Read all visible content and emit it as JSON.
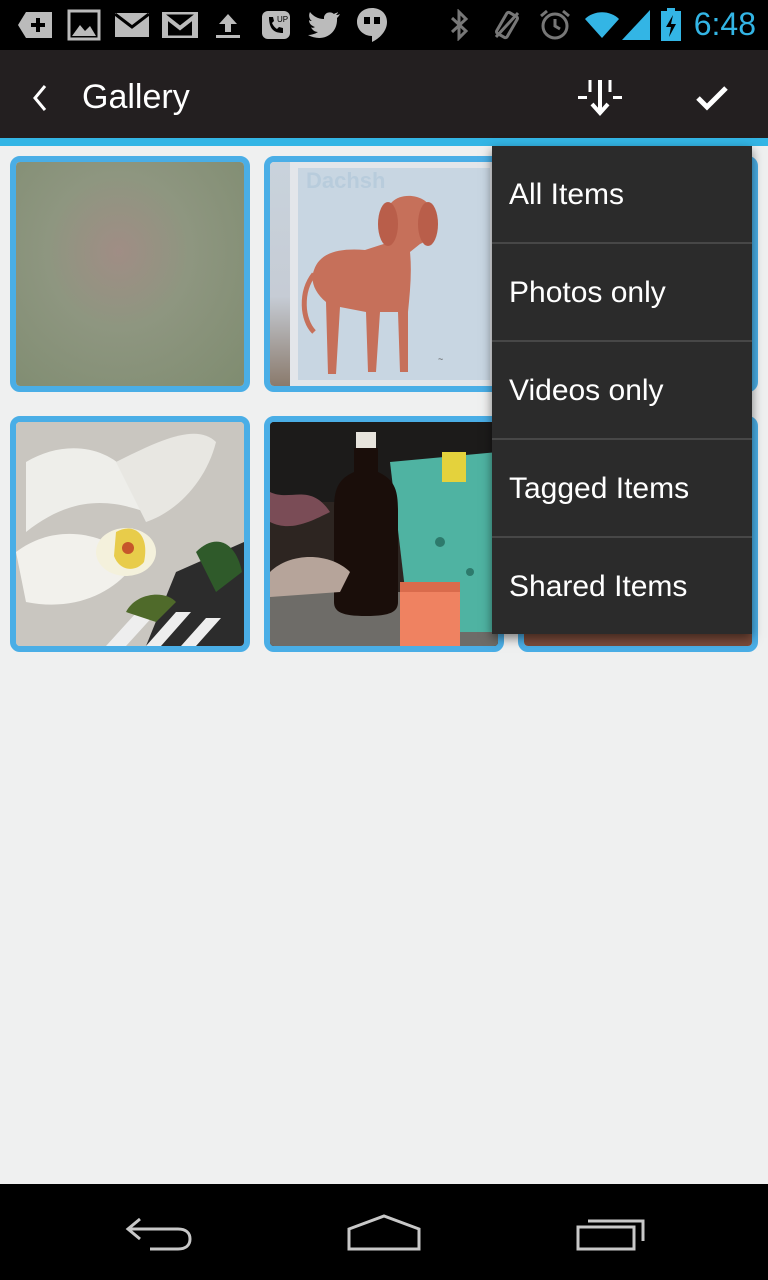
{
  "status_bar": {
    "time": "6:48",
    "icons": [
      "add-icon",
      "gallery-icon",
      "email-icon",
      "gmail-icon",
      "upload-icon",
      "voicemail-icon",
      "twitter-icon",
      "hangouts-icon",
      "bluetooth-icon",
      "vibrate-icon",
      "alarm-icon",
      "wifi-icon",
      "signal-icon",
      "battery-charging-icon"
    ]
  },
  "action_bar": {
    "title": "Gallery",
    "back_icon": "chevron-left-icon",
    "sort_icon": "sort-icon",
    "confirm_icon": "check-icon"
  },
  "gallery": {
    "items": [
      {
        "name": "photo-wall"
      },
      {
        "name": "photo-dog-painting"
      },
      {
        "name": "photo-partial"
      },
      {
        "name": "photo-orchid"
      },
      {
        "name": "photo-bottle"
      },
      {
        "name": "photo-partial-2"
      }
    ]
  },
  "filter_menu": {
    "items": [
      "All Items",
      "Photos only",
      "Videos only",
      "Tagged Items",
      "Shared Items"
    ]
  },
  "nav_bar": {
    "icons": [
      "back-icon",
      "home-icon",
      "recents-icon"
    ]
  },
  "colors": {
    "accent": "#33b5e5",
    "thumb_border": "#4aaee6",
    "action_bar": "#231f20",
    "menu_bg": "#2b2b2b",
    "content_bg": "#eff0f0"
  }
}
